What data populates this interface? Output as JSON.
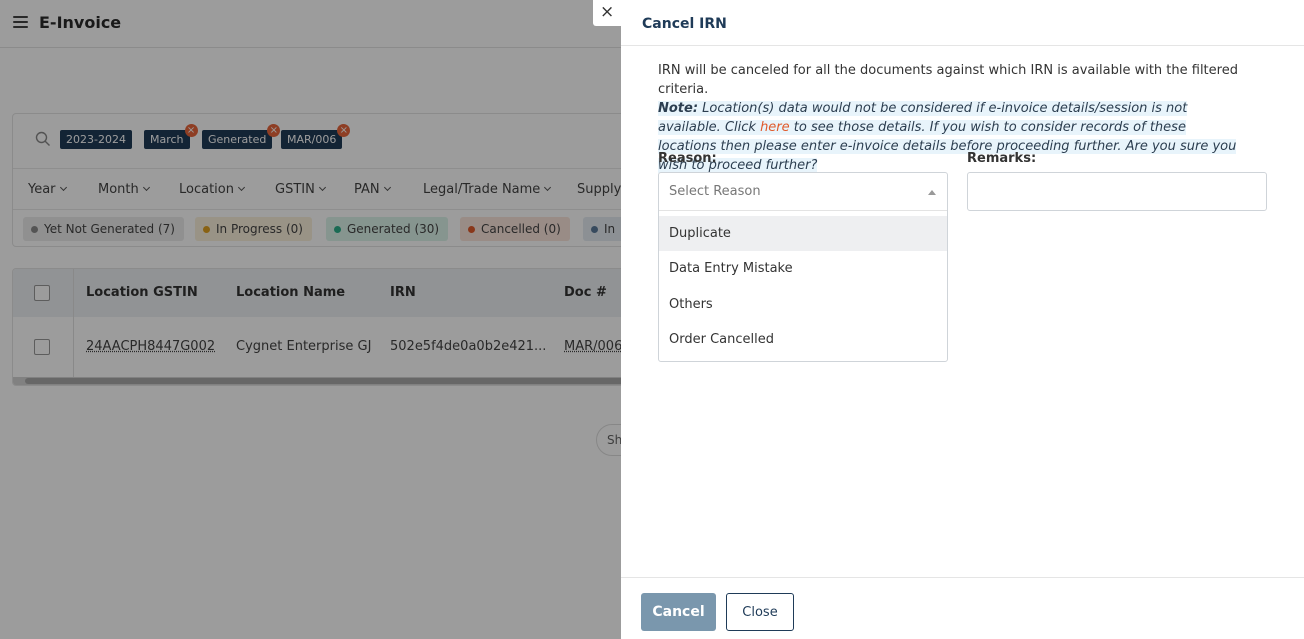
{
  "app": {
    "title": "E-Invoice"
  },
  "filters": {
    "chips": [
      "2023-2024",
      "March",
      "Generated",
      "MAR/006"
    ],
    "dropdowns": [
      "Year",
      "Month",
      "Location",
      "GSTIN",
      "PAN",
      "Legal/Trade Name",
      "Supply"
    ],
    "statuses": [
      {
        "label": "Yet Not Generated (7)",
        "color": "#8a8a8a",
        "bg": "#ececec"
      },
      {
        "label": "In Progress (0)",
        "color": "#e0a020",
        "bg": "#fbf0dc"
      },
      {
        "label": "Generated (30)",
        "color": "#2bb08a",
        "bg": "#dcf3ea"
      },
      {
        "label": "Cancelled (0)",
        "color": "#e05a2b",
        "bg": "#fbe5dc"
      },
      {
        "label": "In",
        "color": "#5a7a9a",
        "bg": "#e5ecf2"
      }
    ]
  },
  "table": {
    "headers": [
      "Location GSTIN",
      "Location Name",
      "IRN",
      "Doc #"
    ],
    "row": [
      "24AACPH8447G002",
      "Cygnet Enterprise GJ",
      "502e5f4de0a0b2e421...",
      "MAR/006"
    ]
  },
  "background_button_label": "Sh",
  "drawer": {
    "title": "Cancel IRN",
    "info": "IRN will be canceled for all the documents against which IRN is available with the filtered criteria.",
    "note_label": "Note:",
    "note_before": " Location(s) data would not be considered if e-invoice details/session is not available. Click ",
    "note_link": "here",
    "note_after": " to see those details. If you wish to consider records of these locations then please enter e-invoice details before proceeding further. Are you sure you wish to proceed further?",
    "reason_label": "Reason:",
    "reason_placeholder": "Select Reason",
    "reason_options": [
      "Duplicate",
      "Data Entry Mistake",
      "Others",
      "Order Cancelled"
    ],
    "highlighted_option": "Duplicate",
    "remarks_label": "Remarks:",
    "remarks_value": "",
    "cancel_button": "Cancel",
    "close_button": "Close",
    "close_icon": "×"
  }
}
